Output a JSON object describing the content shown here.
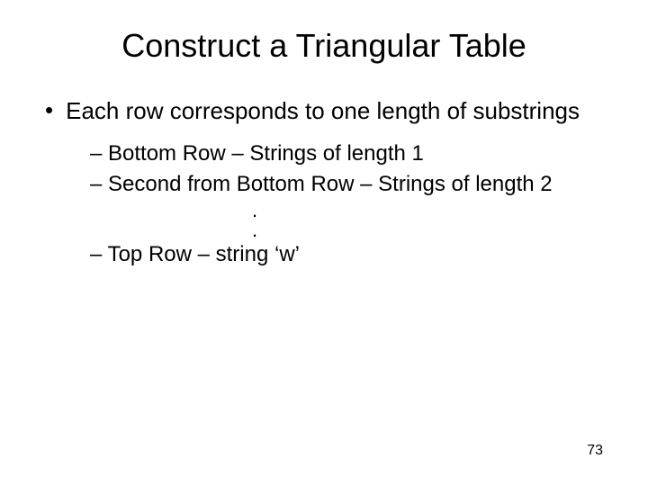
{
  "title": "Construct a Triangular Table",
  "main_bullet": "Each row corresponds to one length of substrings",
  "sub_items": {
    "item1": "– Bottom Row – Strings of length 1",
    "item2": "– Second from Bottom Row – Strings of length 2",
    "dot1": ".",
    "dot2": ".",
    "item3": "– Top Row – string ‘w’"
  },
  "page_number": "73"
}
